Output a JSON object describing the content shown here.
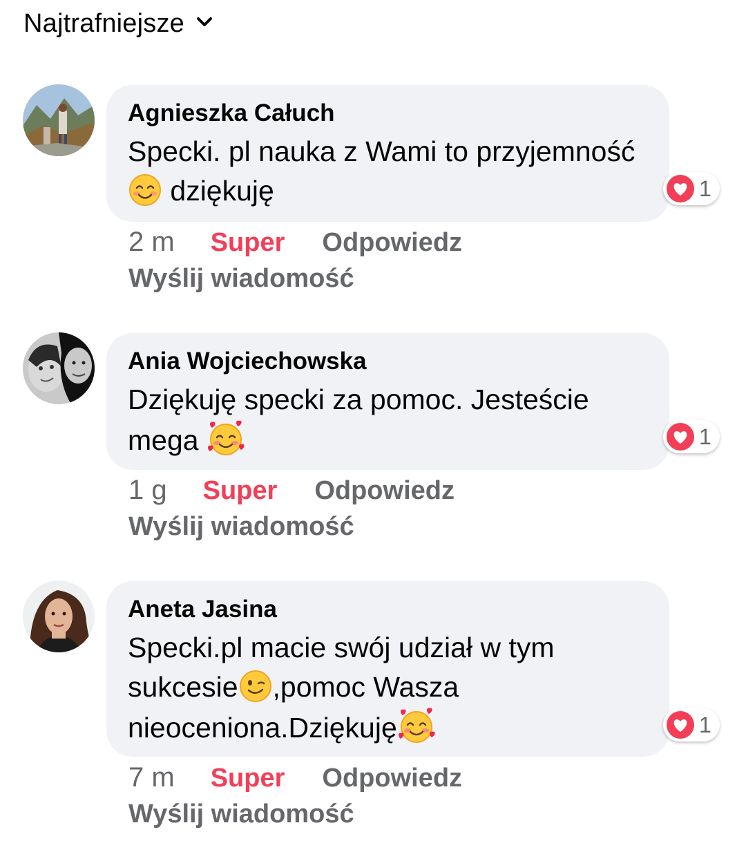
{
  "sort": {
    "label": "Najtrafniejsze",
    "icon": "chevron-down-icon"
  },
  "colors": {
    "bubble_background": "#f0f2f5",
    "text_primary": "#050505",
    "text_secondary": "#65676b",
    "reaction_accent": "#f33e58"
  },
  "comments": [
    {
      "author": "Agnieszka Całuch",
      "text": "Specki. pl nauka z Wami to przyjemność",
      "text_after_emoji": " dziękuję",
      "emoji": "smiling-face-icon",
      "reaction_icon": "heart-reaction-icon",
      "reaction_count": "1",
      "time": "2 m",
      "action_super": "Super",
      "action_reply": "Odpowiedz",
      "action_message": "Wyślij wiadomość"
    },
    {
      "author": "Ania Wojciechowska",
      "text": "Dziękuję specki za pomoc. Jesteście mega ",
      "text_after_emoji": "",
      "emoji": "smiling-face-with-hearts-icon",
      "reaction_icon": "heart-reaction-icon",
      "reaction_count": "1",
      "time": "1 g",
      "action_super": "Super",
      "action_reply": "Odpowiedz",
      "action_message": "Wyślij wiadomość"
    },
    {
      "author": "Aneta Jasina",
      "text": "Specki.pl macie swój udział w tym sukcesie",
      "text_mid": ",pomoc Wasza nieoceniona.Dziękuję",
      "emoji": "winking-face-icon",
      "emoji2": "smiling-face-with-hearts-icon",
      "reaction_icon": "heart-reaction-icon",
      "reaction_count": "1",
      "time": "7 m",
      "action_super": "Super",
      "action_reply": "Odpowiedz",
      "action_message": "Wyślij wiadomość"
    }
  ]
}
